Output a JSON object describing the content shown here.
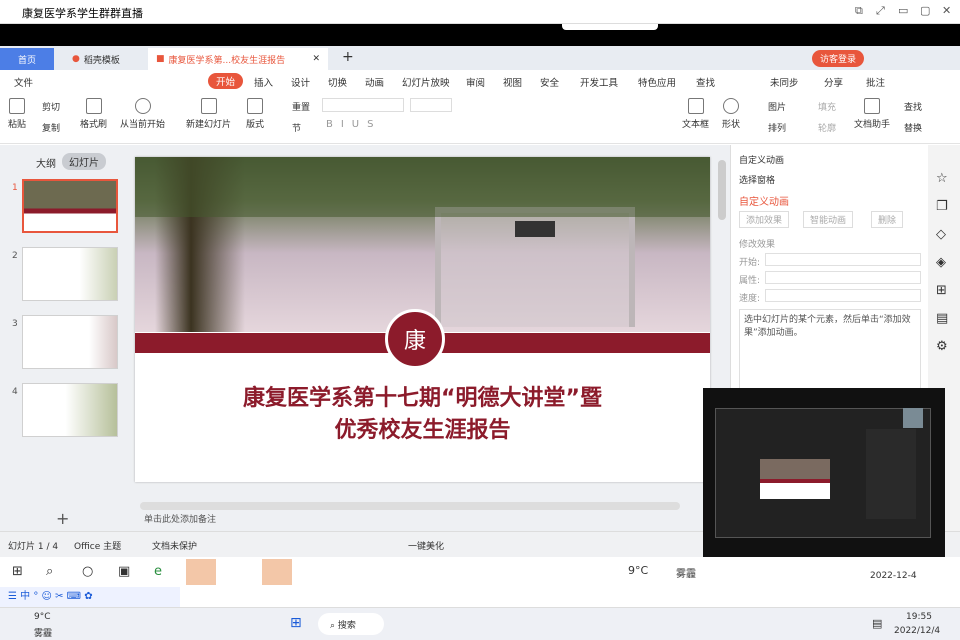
{
  "window": {
    "title": "康复医学系学生群群直播"
  },
  "tabs": {
    "home": "首页",
    "template": "稻壳模板",
    "doc": "康复医学系第...校友生涯报告",
    "login": "访客登录"
  },
  "menu": {
    "file": "文件",
    "start": "开始",
    "insert": "插入",
    "design": "设计",
    "transition": "切换",
    "animation": "动画",
    "show": "幻灯片放映",
    "review": "审阅",
    "view": "视图",
    "security": "安全",
    "dev": "开发工具",
    "special": "特色应用",
    "search": "查找",
    "unsynced": "未同步",
    "share": "分享",
    "comment": "批注"
  },
  "toolbar": {
    "paste": "粘贴",
    "cut": "剪切",
    "copy": "复制",
    "format": "格式刷",
    "from_start": "从当前开始",
    "new_slide": "新建幻灯片",
    "layout": "版式",
    "section": "节",
    "reset": "重置",
    "textbox": "文本框",
    "shape": "形状",
    "arrange": "排列",
    "picture": "图片",
    "fill": "填充",
    "outline": "轮廓",
    "doc_helper": "文档助手",
    "find": "查找",
    "replace": "替换"
  },
  "left": {
    "outline": "大纲",
    "slides": "幻灯片",
    "nums": [
      "1",
      "2",
      "3",
      "4"
    ]
  },
  "slide": {
    "line1": "康复医学系第十七期“明德大讲堂”暨",
    "line2": "优秀校友生涯报告",
    "seal": "康"
  },
  "panel": {
    "title": "自定义动画",
    "select": "选择窗格",
    "custom": "自定义动画",
    "add": "添加效果",
    "smart": "智能动画",
    "delete": "删除",
    "modify": "修改效果",
    "start": "开始:",
    "attr": "属性:",
    "speed": "速度:",
    "hint": "选中幻灯片的某个元素，然后单击“添加效果”添加动画。"
  },
  "status": {
    "slide": "幻灯片 1 / 4",
    "theme": "Office 主题",
    "protect": "文档未保护",
    "beautify": "一键美化",
    "notes": "单击此处添加备注"
  },
  "taskbar1": {
    "weather": "9°C",
    "fog": "雾霾",
    "date": "2022-12-4"
  },
  "taskbar2": {
    "temp": "9°C",
    "fog": "雾霾",
    "search": "搜索",
    "time": "19:55",
    "date": "2022/12/4"
  }
}
